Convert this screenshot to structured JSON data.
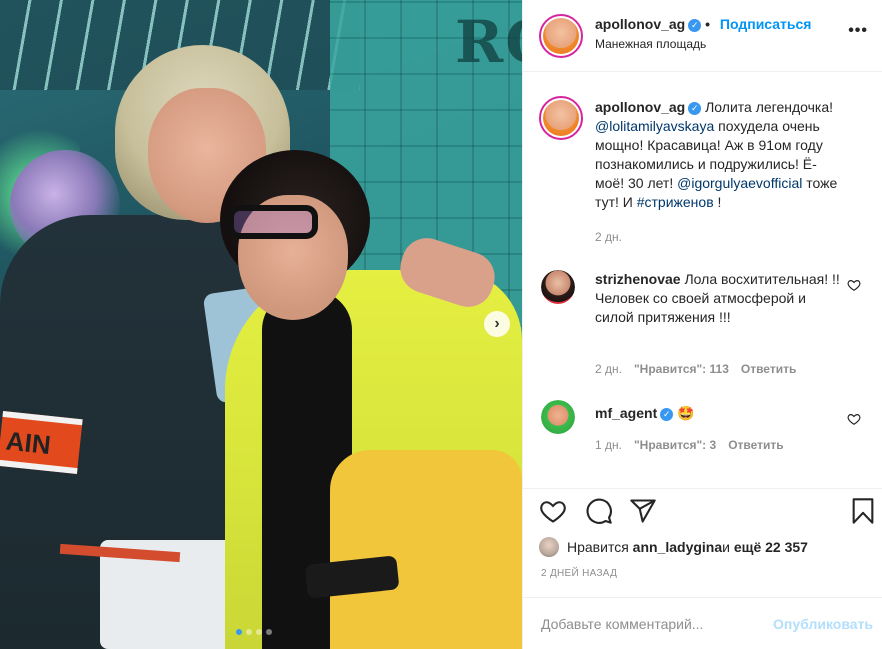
{
  "post": {
    "author": "apollonov_ag",
    "follow_label": "Подписаться",
    "location": "Манежная площадь",
    "more_label": "•••",
    "next_arrow": "›"
  },
  "photo": {
    "arm_band_text": "AIN"
  },
  "caption": {
    "username": "apollonov_ag",
    "text_1": " Лолита легендочка! ",
    "mention_1": "@lolitamilyavskaya",
    "text_2": " похудела очень мощно! Красавица! Аж в 91ом году познакомились и подружились! Ё-моё! 30 лет! ",
    "mention_2": "@igorgulyaevofficial",
    "text_3": " тоже тут! И ",
    "hashtag": "#стриженов",
    "text_4": " !",
    "time": "2 дн."
  },
  "comments": [
    {
      "username": "strizhenovae",
      "text": " Лола восхитительная! !! Человек со своей атмосферой и силой притяжения !!!",
      "time": "2 дн.",
      "likes": "\"Нравится\": 113",
      "reply": "Ответить"
    },
    {
      "username": "mf_agent",
      "text": " 🤩",
      "time": "1 дн.",
      "likes": "\"Нравится\": 3",
      "reply": "Ответить"
    }
  ],
  "likes_line": {
    "prefix": "Нравится ",
    "user": "ann_ladygina",
    "middle": " и ",
    "count": "ещё 22 357"
  },
  "date_label": "2 ДНЕЙ НАЗАД",
  "add_comment": {
    "placeholder": "Добавьте комментарий...",
    "publish": "Опубликовать"
  },
  "colors": {
    "accent": "#0095f6",
    "verified": "#3897f0",
    "text": "#262626",
    "muted": "#8e8e8e"
  },
  "icons": [
    "heart-icon",
    "comment-icon",
    "share-icon",
    "bookmark-icon",
    "verified-icon",
    "more-icon",
    "next-arrow-icon"
  ]
}
